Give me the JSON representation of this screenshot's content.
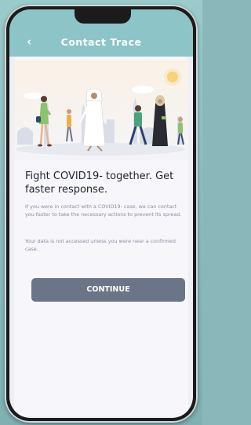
{
  "header": {
    "back_glyph": "‹",
    "title": "Contact Trace"
  },
  "main": {
    "headline": "Fight COVID19- together. Get faster response.",
    "paragraph_1": "If you were in contact with a COVID19- case, we can contact you faster to take the necessary actions to prevent its spread.",
    "paragraph_2": "Your data is not accessed unless you were near a confirmed case.",
    "continue_label": "CONTINUE"
  },
  "colors": {
    "header": "#8cc4c8",
    "button": "#6b7587",
    "text_dark": "#1f2233",
    "text_muted": "#8a8da0"
  }
}
